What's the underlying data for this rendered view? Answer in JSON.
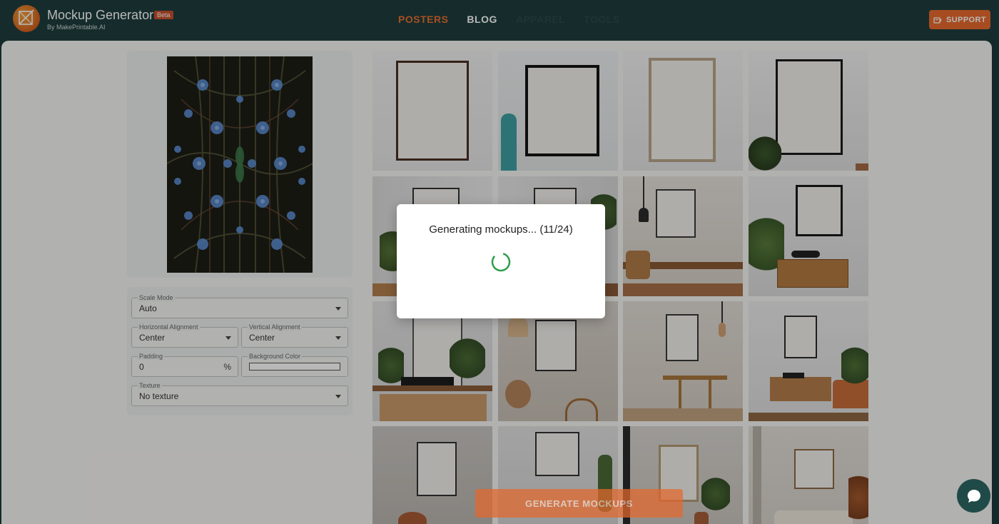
{
  "header": {
    "title": "Mockup Generator",
    "badge": "Beta",
    "subtitle": "By MakePrintable.AI",
    "nav": [
      {
        "label": "POSTERS"
      },
      {
        "label": "BLOG"
      },
      {
        "label": "APPAREL"
      },
      {
        "label": "TOOLS"
      }
    ],
    "support_label": "SUPPORT"
  },
  "controls": {
    "scale_mode": {
      "label": "Scale Mode",
      "value": "Auto"
    },
    "horizontal_alignment": {
      "label": "Horizontal Alignment",
      "value": "Center"
    },
    "vertical_alignment": {
      "label": "Vertical Alignment",
      "value": "Center"
    },
    "padding": {
      "label": "Padding",
      "value": "0",
      "unit": "%"
    },
    "background_color": {
      "label": "Background Color",
      "value": "#ffffff"
    },
    "texture": {
      "label": "Texture",
      "value": "No texture"
    }
  },
  "generate_label": "GENERATE MOCKUPS",
  "modal": {
    "message": "Generating mockups... (11/24)"
  },
  "colors": {
    "accent": "#e8702f",
    "header_bg": "#1f3d3d",
    "spinner": "#2e9e4a"
  }
}
